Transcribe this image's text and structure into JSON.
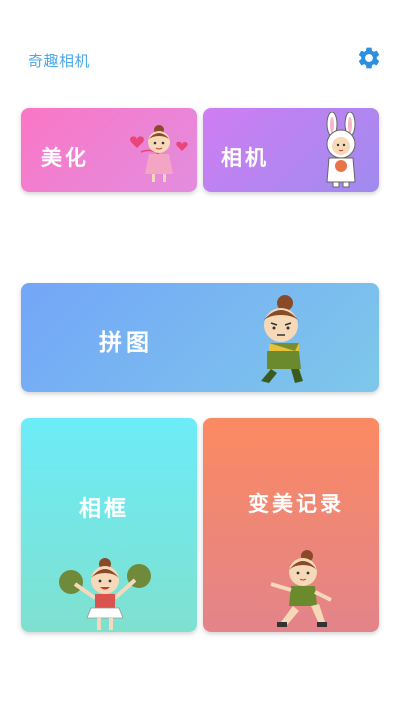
{
  "header": {
    "app_title": "奇趣相机",
    "settings_icon": "gear-icon",
    "accent_color": "#2d8fe0"
  },
  "cards": {
    "beautify": {
      "label": "美化",
      "sticker": "girl-with-hearts-sticker"
    },
    "camera": {
      "label": "相机",
      "sticker": "bunny-costume-kid-sticker"
    },
    "collage": {
      "label": "拼图",
      "sticker": "grumpy-girl-sticker"
    },
    "frame": {
      "label": "相框",
      "sticker": "cheerleader-girl-sticker"
    },
    "record": {
      "label": "变美记录",
      "sticker": "running-girl-sticker"
    }
  }
}
